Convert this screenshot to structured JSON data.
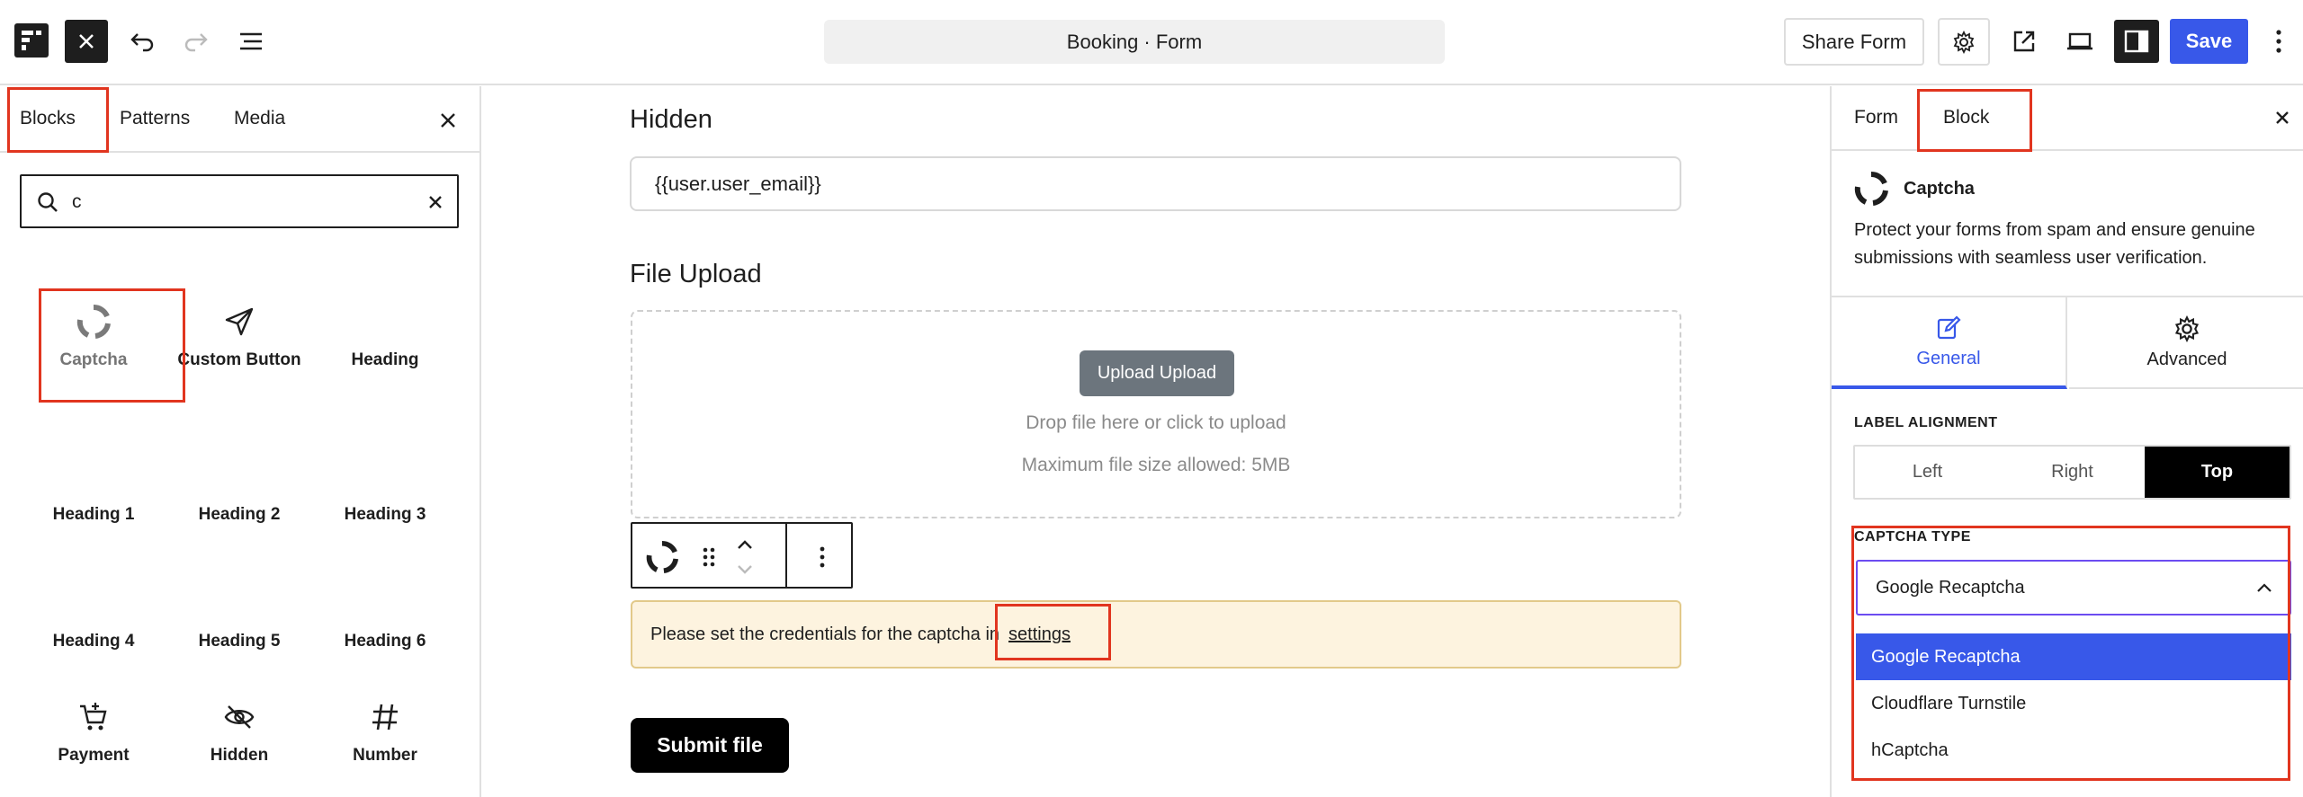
{
  "topbar": {
    "doc_title": "Booking · Form",
    "share_label": "Share Form",
    "save_label": "Save"
  },
  "left_panel": {
    "tabs": [
      "Blocks",
      "Patterns",
      "Media"
    ],
    "search": {
      "value": "c"
    },
    "blocks": [
      {
        "label": "Captcha",
        "icon": "captcha-icon"
      },
      {
        "label": "Custom Button",
        "icon": "send-icon"
      },
      {
        "label": "Heading",
        "icon": ""
      },
      {
        "label": "Heading 1",
        "icon": ""
      },
      {
        "label": "Heading 2",
        "icon": ""
      },
      {
        "label": "Heading 3",
        "icon": ""
      },
      {
        "label": "Heading 4",
        "icon": ""
      },
      {
        "label": "Heading 5",
        "icon": ""
      },
      {
        "label": "Heading 6",
        "icon": ""
      },
      {
        "label": "Payment",
        "icon": "cart-icon"
      },
      {
        "label": "Hidden",
        "icon": "eye-slash-icon"
      },
      {
        "label": "Number",
        "icon": "hash-icon"
      }
    ]
  },
  "canvas": {
    "hidden_label": "Hidden",
    "hidden_value": "{{user.user_email}}",
    "file_upload_label": "File Upload",
    "upload_button": "Upload Upload",
    "drop_text": "Drop file here or click to upload",
    "max_size": "Maximum file size allowed: 5MB",
    "notice_text": "Please set the credentials for the captcha in",
    "notice_link": "settings",
    "submit_label": "Submit file"
  },
  "right_panel": {
    "tabs": [
      "Form",
      "Block"
    ],
    "block_name": "Captcha",
    "block_desc": "Protect your forms from spam and ensure genuine submissions with seamless user verification.",
    "settings_tabs": [
      "General",
      "Advanced"
    ],
    "label_alignment": {
      "title": "LABEL ALIGNMENT",
      "options": [
        "Left",
        "Right",
        "Top"
      ],
      "selected": "Top"
    },
    "captcha_type": {
      "title": "CAPTCHA TYPE",
      "selected": "Google Recaptcha",
      "options": [
        "Google Recaptcha",
        "Cloudflare Turnstile",
        "hCaptcha"
      ]
    }
  },
  "colors": {
    "accent": "#3858e9",
    "annotation": "#e1351f",
    "notice_bg": "#fdf3df",
    "select_focus": "#6c4cf1"
  }
}
